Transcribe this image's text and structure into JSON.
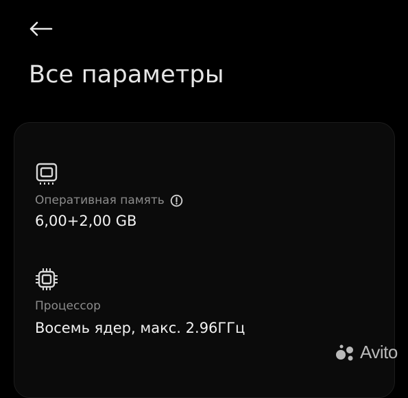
{
  "header": {
    "title": "Все параметры",
    "back_icon": "arrow-left-icon"
  },
  "specs": {
    "ram": {
      "icon": "ram-chip-icon",
      "label": "Оперативная память",
      "value": "6,00+2,00 GB",
      "info_icon": "info-circle-icon"
    },
    "cpu": {
      "icon": "processor-icon",
      "label": "Процессор",
      "value": "Восемь ядер, макс. 2.96ГГц"
    }
  },
  "watermark": {
    "text": "Avito"
  },
  "colors": {
    "background": "#000000",
    "card": "#0b0b0b",
    "label": "#8c8c8c",
    "value": "#f2f2f2"
  }
}
